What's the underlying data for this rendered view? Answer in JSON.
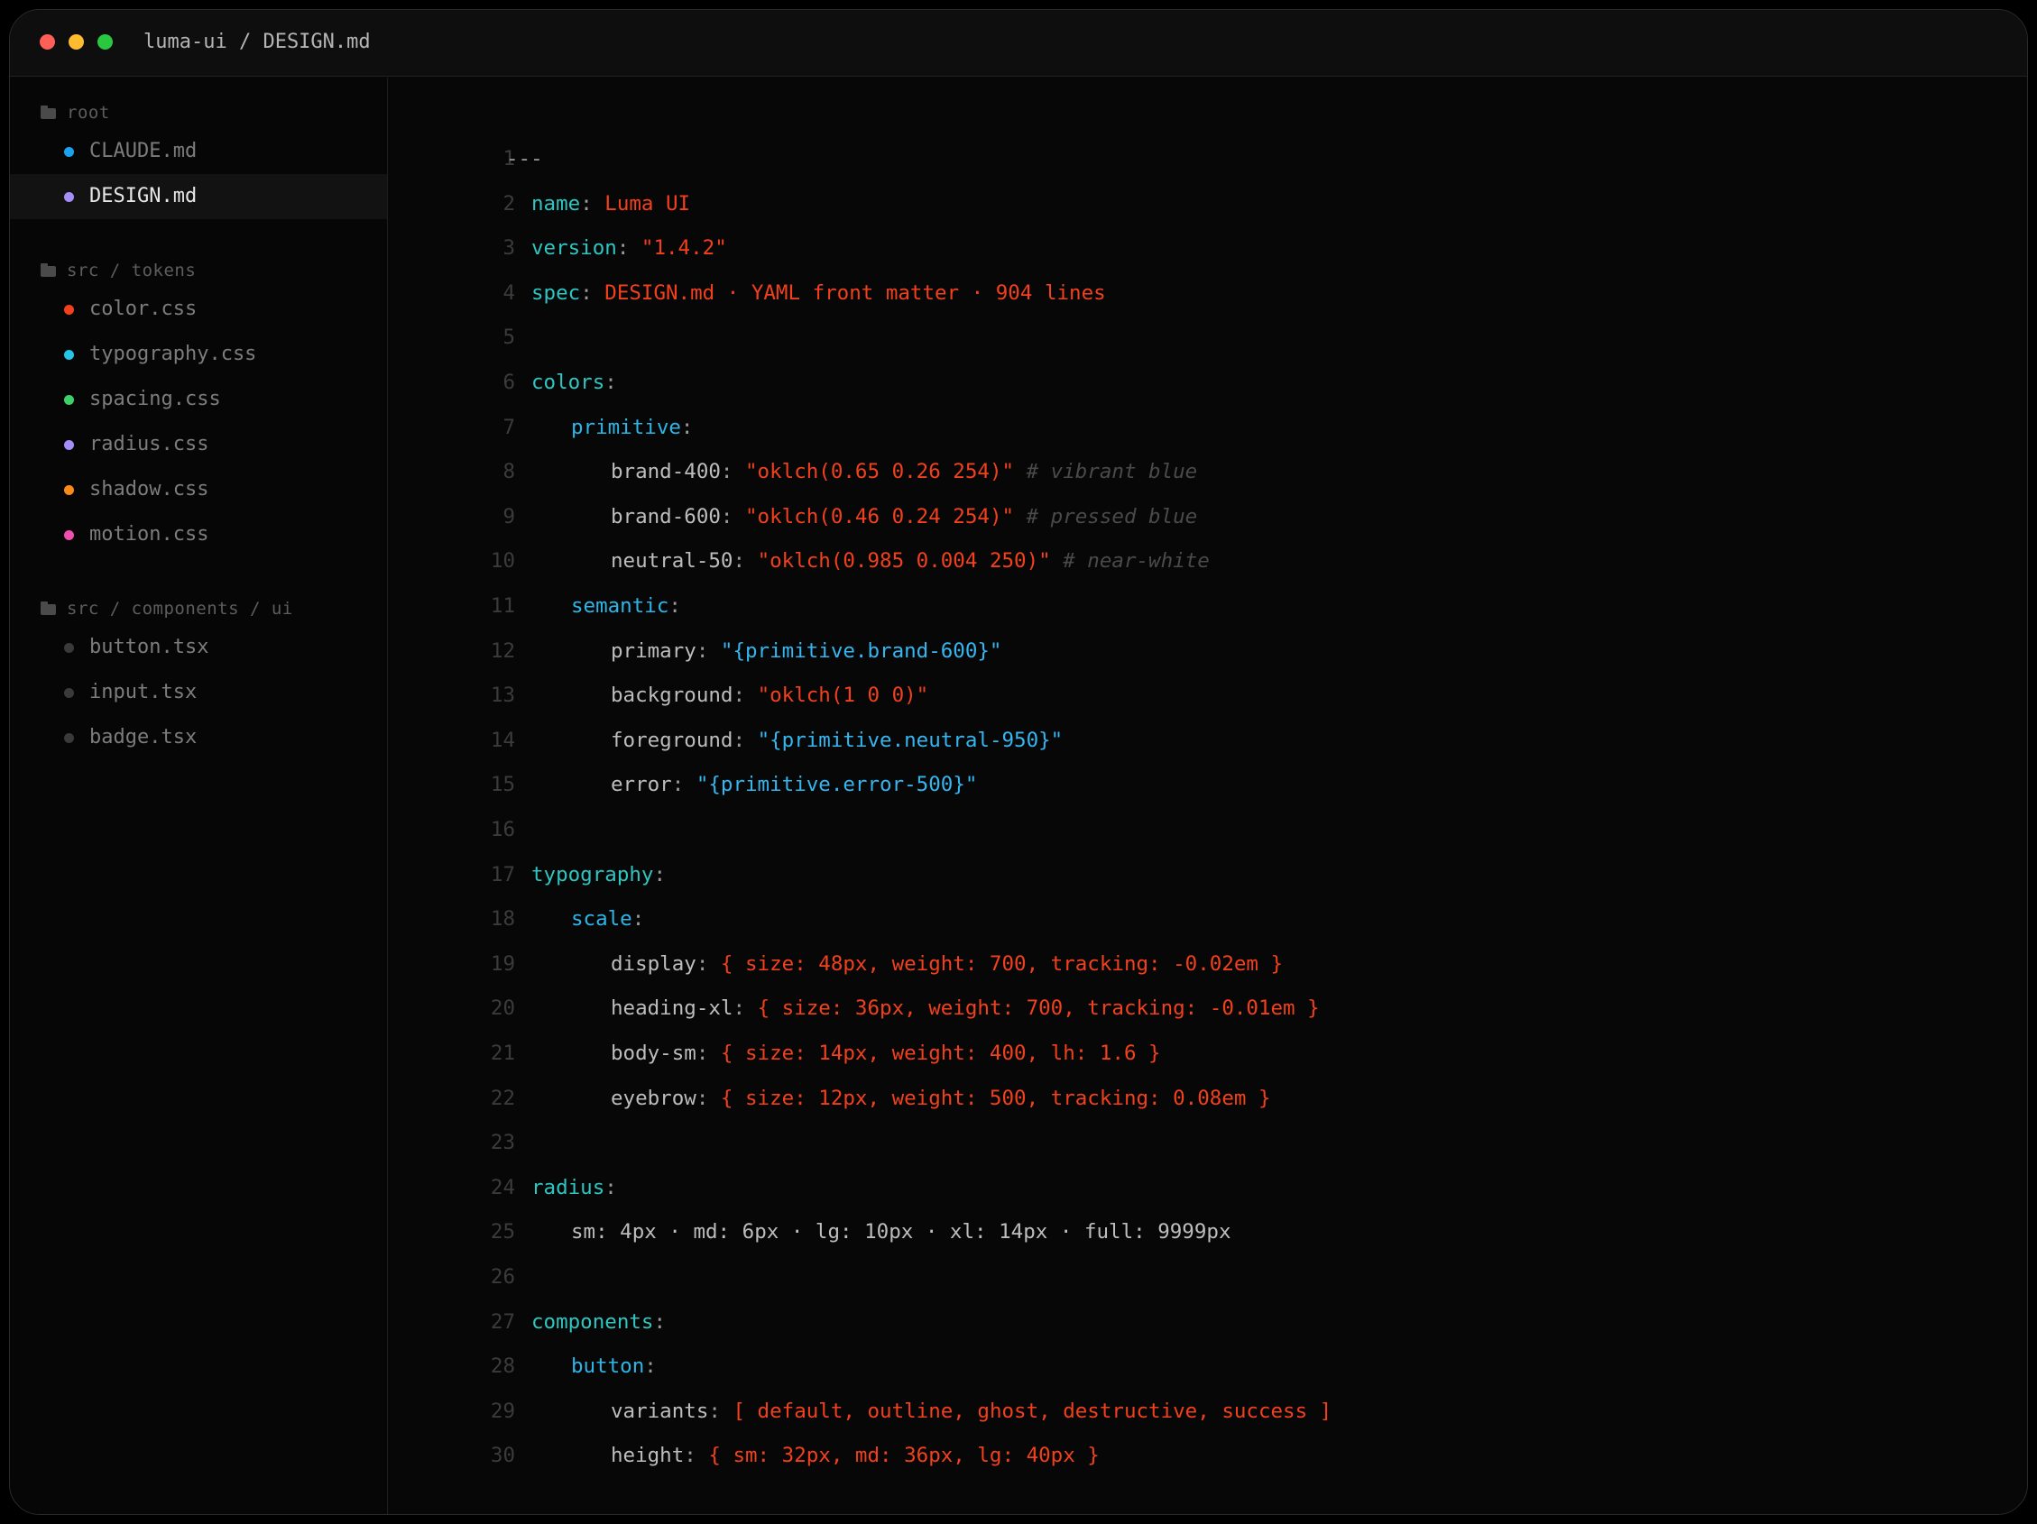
{
  "window": {
    "title": "luma-ui / DESIGN.md"
  },
  "colors": {
    "close": "#ff5f57",
    "minimize": "#febc2e",
    "maximize": "#28c840",
    "key_top": "#2fc5c0",
    "key_nested": "#2eb5e8",
    "string": "#f2401d",
    "reference": "#34b6f0",
    "comment": "#4a4a4a"
  },
  "sidebar": {
    "groups": [
      {
        "label": "root",
        "files": [
          {
            "name": "CLAUDE.md",
            "dot": "#1aa3ec",
            "active": false
          },
          {
            "name": "DESIGN.md",
            "dot": "#a48ef8",
            "active": true
          }
        ]
      },
      {
        "label": "src / tokens",
        "files": [
          {
            "name": "color.css",
            "dot": "#f2401d",
            "active": false
          },
          {
            "name": "typography.css",
            "dot": "#26c4e6",
            "active": false
          },
          {
            "name": "spacing.css",
            "dot": "#3ecf6a",
            "active": false
          },
          {
            "name": "radius.css",
            "dot": "#a48ef8",
            "active": false
          },
          {
            "name": "shadow.css",
            "dot": "#f98a18",
            "active": false
          },
          {
            "name": "motion.css",
            "dot": "#ef4fae",
            "active": false
          }
        ]
      },
      {
        "label": "src / components / ui",
        "files": [
          {
            "name": "button.tsx",
            "dot": "#3a3a3a",
            "active": false
          },
          {
            "name": "input.tsx",
            "dot": "#3a3a3a",
            "active": false
          },
          {
            "name": "badge.tsx",
            "dot": "#3a3a3a",
            "active": false
          }
        ]
      }
    ]
  },
  "editor": {
    "lines": [
      {
        "n": "1",
        "indent": 0,
        "tokens": [
          {
            "t": "---",
            "c": "dash"
          }
        ]
      },
      {
        "n": "2",
        "indent": 1,
        "tokens": [
          {
            "t": "name",
            "c": "k1"
          },
          {
            "t": ": ",
            "c": "p"
          },
          {
            "t": "Luma UI",
            "c": "s"
          }
        ]
      },
      {
        "n": "3",
        "indent": 1,
        "tokens": [
          {
            "t": "version",
            "c": "k1"
          },
          {
            "t": ": ",
            "c": "p"
          },
          {
            "t": "\"1.4.2\"",
            "c": "s"
          }
        ]
      },
      {
        "n": "4",
        "indent": 1,
        "tokens": [
          {
            "t": "spec",
            "c": "k1"
          },
          {
            "t": ": ",
            "c": "p"
          },
          {
            "t": "DESIGN.md · YAML front matter · 904 lines",
            "c": "s"
          }
        ]
      },
      {
        "n": "5",
        "indent": 1,
        "tokens": []
      },
      {
        "n": "6",
        "indent": 1,
        "tokens": [
          {
            "t": "colors",
            "c": "k1"
          },
          {
            "t": ":",
            "c": "p"
          }
        ]
      },
      {
        "n": "7",
        "indent": 2,
        "tokens": [
          {
            "t": "primitive",
            "c": "k2"
          },
          {
            "t": ":",
            "c": "p"
          }
        ]
      },
      {
        "n": "8",
        "indent": 3,
        "tokens": [
          {
            "t": "brand-400",
            "c": "k3"
          },
          {
            "t": ": ",
            "c": "p"
          },
          {
            "t": "\"oklch(0.65 0.26 254)\"",
            "c": "s"
          },
          {
            "t": " # vibrant blue",
            "c": "cm"
          }
        ]
      },
      {
        "n": "9",
        "indent": 3,
        "tokens": [
          {
            "t": "brand-600",
            "c": "k3"
          },
          {
            "t": ": ",
            "c": "p"
          },
          {
            "t": "\"oklch(0.46 0.24 254)\"",
            "c": "s"
          },
          {
            "t": " # pressed blue",
            "c": "cm"
          }
        ]
      },
      {
        "n": "10",
        "indent": 3,
        "tokens": [
          {
            "t": "neutral-50",
            "c": "k3"
          },
          {
            "t": ": ",
            "c": "p"
          },
          {
            "t": "\"oklch(0.985 0.004 250)\"",
            "c": "s"
          },
          {
            "t": " # near-white",
            "c": "cm"
          }
        ]
      },
      {
        "n": "11",
        "indent": 2,
        "tokens": [
          {
            "t": "semantic",
            "c": "k2"
          },
          {
            "t": ":",
            "c": "p"
          }
        ]
      },
      {
        "n": "12",
        "indent": 3,
        "tokens": [
          {
            "t": "primary",
            "c": "k3"
          },
          {
            "t": ": ",
            "c": "p"
          },
          {
            "t": "\"{primitive.brand-600}\"",
            "c": "ref"
          }
        ]
      },
      {
        "n": "13",
        "indent": 3,
        "tokens": [
          {
            "t": "background",
            "c": "k3"
          },
          {
            "t": ": ",
            "c": "p"
          },
          {
            "t": "\"oklch(1 0 0)\"",
            "c": "s"
          }
        ]
      },
      {
        "n": "14",
        "indent": 3,
        "tokens": [
          {
            "t": "foreground",
            "c": "k3"
          },
          {
            "t": ": ",
            "c": "p"
          },
          {
            "t": "\"{primitive.neutral-950}\"",
            "c": "ref"
          }
        ]
      },
      {
        "n": "15",
        "indent": 3,
        "tokens": [
          {
            "t": "error",
            "c": "k3"
          },
          {
            "t": ": ",
            "c": "p"
          },
          {
            "t": "\"{primitive.error-500}\"",
            "c": "ref"
          }
        ]
      },
      {
        "n": "16",
        "indent": 1,
        "tokens": []
      },
      {
        "n": "17",
        "indent": 1,
        "tokens": [
          {
            "t": "typography",
            "c": "k1"
          },
          {
            "t": ":",
            "c": "p"
          }
        ]
      },
      {
        "n": "18",
        "indent": 2,
        "tokens": [
          {
            "t": "scale",
            "c": "k2"
          },
          {
            "t": ":",
            "c": "p"
          }
        ]
      },
      {
        "n": "19",
        "indent": 3,
        "tokens": [
          {
            "t": "display",
            "c": "k3"
          },
          {
            "t": ": ",
            "c": "p"
          },
          {
            "t": "{ size: 48px, weight: 700, tracking: -0.02em }",
            "c": "s"
          }
        ]
      },
      {
        "n": "20",
        "indent": 3,
        "tokens": [
          {
            "t": "heading-xl",
            "c": "k3"
          },
          {
            "t": ": ",
            "c": "p"
          },
          {
            "t": "{ size: 36px, weight: 700, tracking: -0.01em }",
            "c": "s"
          }
        ]
      },
      {
        "n": "21",
        "indent": 3,
        "tokens": [
          {
            "t": "body-sm",
            "c": "k3"
          },
          {
            "t": ": ",
            "c": "p"
          },
          {
            "t": "{ size: 14px, weight: 400, lh: 1.6 }",
            "c": "s"
          }
        ]
      },
      {
        "n": "22",
        "indent": 3,
        "tokens": [
          {
            "t": "eyebrow",
            "c": "k3"
          },
          {
            "t": ": ",
            "c": "p"
          },
          {
            "t": "{ size: 12px, weight: 500, tracking: 0.08em }",
            "c": "s"
          }
        ]
      },
      {
        "n": "23",
        "indent": 1,
        "tokens": []
      },
      {
        "n": "24",
        "indent": 1,
        "tokens": [
          {
            "t": "radius",
            "c": "k1"
          },
          {
            "t": ":",
            "c": "p"
          }
        ]
      },
      {
        "n": "25",
        "indent": 2,
        "tokens": [
          {
            "t": "sm: 4px · md: 6px · lg: 10px · xl: 14px · full: 9999px",
            "c": "k3"
          }
        ]
      },
      {
        "n": "26",
        "indent": 1,
        "tokens": []
      },
      {
        "n": "27",
        "indent": 1,
        "tokens": [
          {
            "t": "components",
            "c": "k1"
          },
          {
            "t": ":",
            "c": "p"
          }
        ]
      },
      {
        "n": "28",
        "indent": 2,
        "tokens": [
          {
            "t": "button",
            "c": "k2"
          },
          {
            "t": ":",
            "c": "p"
          }
        ]
      },
      {
        "n": "29",
        "indent": 3,
        "tokens": [
          {
            "t": "variants",
            "c": "k3"
          },
          {
            "t": ": ",
            "c": "p"
          },
          {
            "t": "[ default, outline, ghost, destructive, success ]",
            "c": "s"
          }
        ]
      },
      {
        "n": "30",
        "indent": 3,
        "tokens": [
          {
            "t": "height",
            "c": "k3"
          },
          {
            "t": ": ",
            "c": "p"
          },
          {
            "t": "{ sm: 32px, md: 36px, lg: 40px }",
            "c": "s"
          }
        ]
      }
    ]
  }
}
